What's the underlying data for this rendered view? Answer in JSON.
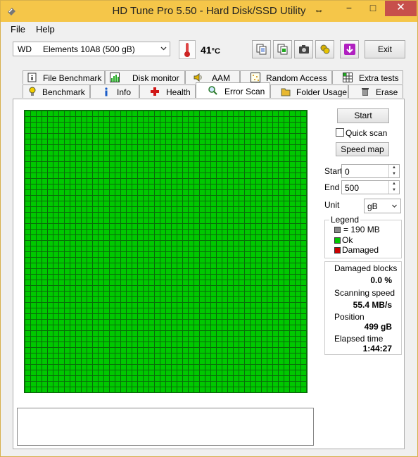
{
  "app": {
    "title": "HD Tune Pro 5.50 - Hard Disk/SSD Utility"
  },
  "window_controls": {
    "minimize": "−",
    "maximize": "□",
    "close": "✕",
    "pin": "⇔"
  },
  "menu": {
    "items": [
      "File",
      "Help"
    ]
  },
  "toolbar": {
    "drive_vendor": "WD",
    "drive_model": "Elements 10A8 (500 gB)",
    "temperature_value": "41",
    "temperature_unit": "°C",
    "exit_label": "Exit",
    "buttons": [
      "copy-info-icon",
      "copy-screenshot-icon",
      "camera-icon",
      "options-icon",
      "download-icon"
    ]
  },
  "tabs": {
    "row_top": [
      {
        "label": "File Benchmark",
        "icon": "info-page-icon"
      },
      {
        "label": "Disk monitor",
        "icon": "chart-icon"
      },
      {
        "label": "AAM",
        "icon": "speaker-icon"
      },
      {
        "label": "Random Access",
        "icon": "dots-icon"
      },
      {
        "label": "Extra tests",
        "icon": "grid-icon"
      }
    ],
    "row_bottom": [
      {
        "label": "Benchmark",
        "icon": "bulb-icon"
      },
      {
        "label": "Info",
        "icon": "info-icon"
      },
      {
        "label": "Health",
        "icon": "health-cross-icon"
      },
      {
        "label": "Error Scan",
        "icon": "magnifier-icon",
        "active": true
      },
      {
        "label": "Folder Usage",
        "icon": "folder-icon"
      },
      {
        "label": "Erase",
        "icon": "trash-icon"
      }
    ]
  },
  "scan": {
    "start_button": "Start",
    "quick_scan_label": "Quick scan",
    "quick_scan_checked": false,
    "speed_map_button": "Speed map",
    "start_label": "Start",
    "start_value": "0",
    "end_label": "End",
    "end_value": "500",
    "unit_label": "Unit",
    "unit_value": "gB",
    "grid_status": "ok",
    "grid_color": "#00c800"
  },
  "legend": {
    "title": "Legend",
    "items": [
      {
        "label": "= 190 MB",
        "color": "#888888"
      },
      {
        "label": "Ok",
        "color": "#00c800"
      },
      {
        "label": "Damaged",
        "color": "#cc0000"
      }
    ]
  },
  "stats": {
    "damaged_blocks_label": "Damaged blocks",
    "damaged_blocks_value": "0.0 %",
    "scanning_speed_label": "Scanning speed",
    "scanning_speed_value": "55.4 MB/s",
    "position_label": "Position",
    "position_value": "499 gB",
    "elapsed_label": "Elapsed time",
    "elapsed_value": "1:44:27"
  },
  "log": {
    "text": ""
  }
}
